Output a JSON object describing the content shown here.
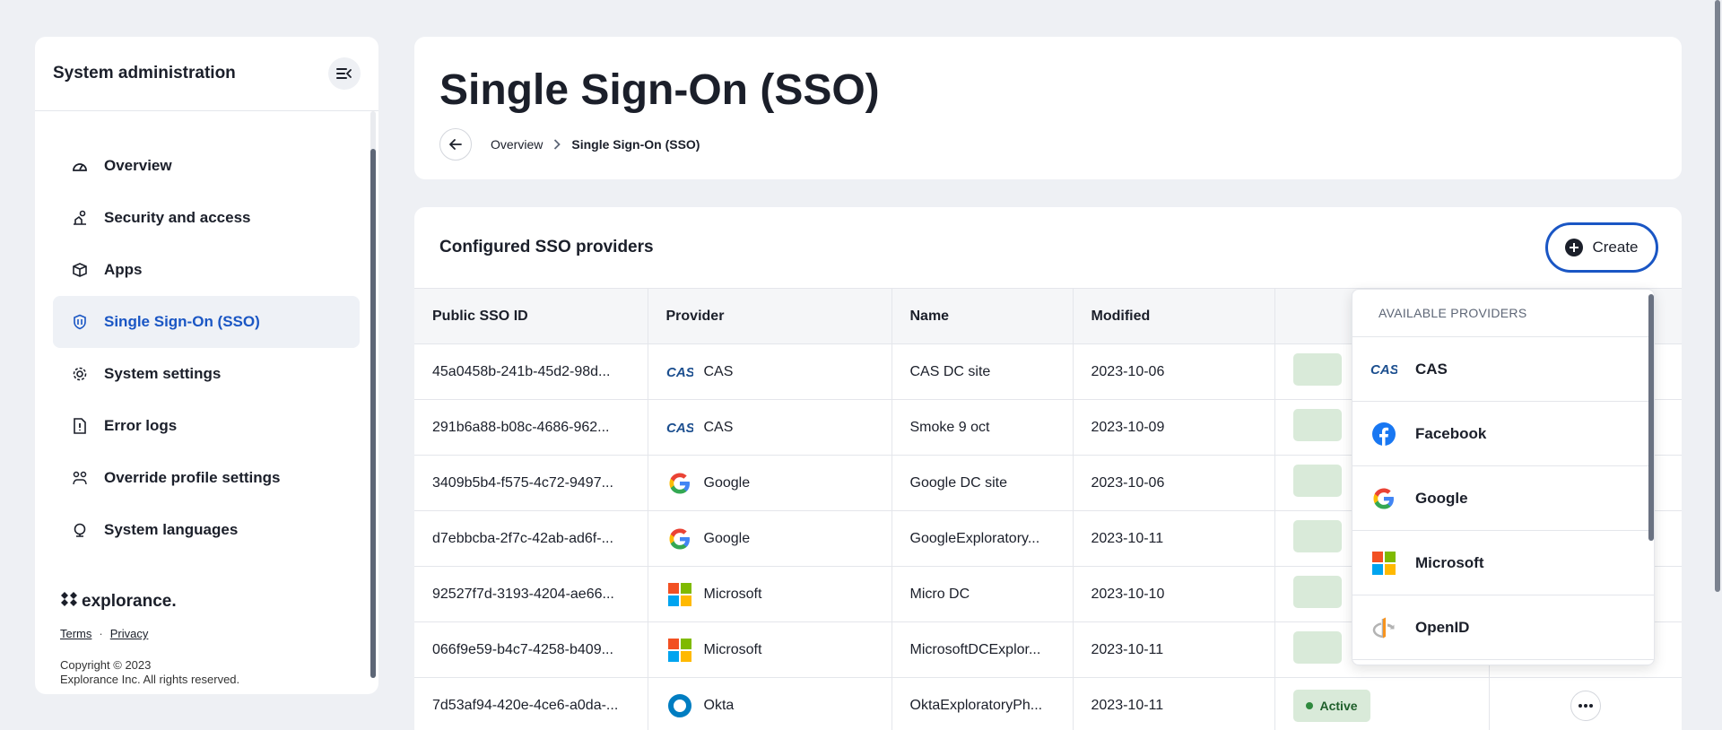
{
  "sidebar": {
    "title": "System administration",
    "items": [
      {
        "label": "Overview",
        "icon": "gauge-icon"
      },
      {
        "label": "Security and access",
        "icon": "security-icon"
      },
      {
        "label": "Apps",
        "icon": "apps-icon"
      },
      {
        "label": "Single Sign-On (SSO)",
        "icon": "shield-icon",
        "active": true
      },
      {
        "label": "System settings",
        "icon": "settings-icon"
      },
      {
        "label": "Error logs",
        "icon": "error-log-icon"
      },
      {
        "label": "Override profile settings",
        "icon": "override-icon"
      },
      {
        "label": "System languages",
        "icon": "globe-icon"
      }
    ],
    "footer": {
      "brand": "explorance.",
      "terms": "Terms",
      "separator": "·",
      "privacy": "Privacy",
      "copyright_line1": "Copyright © 2023",
      "copyright_line2": "Explorance Inc. All rights reserved."
    }
  },
  "header": {
    "title": "Single Sign-On (SSO)",
    "breadcrumb": {
      "parent": "Overview",
      "current": "Single Sign-On (SSO)"
    }
  },
  "providers_card": {
    "title": "Configured SSO providers",
    "create_label": "Create",
    "columns": [
      "Public SSO ID",
      "Provider",
      "Name",
      "Modified",
      "",
      ""
    ],
    "rows": [
      {
        "id": "45a0458b-241b-45d2-98d...",
        "provider": "CAS",
        "logo": "cas-logo",
        "name": "CAS DC site",
        "modified": "2023-10-06",
        "status": ""
      },
      {
        "id": "291b6a88-b08c-4686-962...",
        "provider": "CAS",
        "logo": "cas-logo",
        "name": "Smoke 9 oct",
        "modified": "2023-10-09",
        "status": ""
      },
      {
        "id": "3409b5b4-f575-4c72-9497...",
        "provider": "Google",
        "logo": "google-logo",
        "name": "Google DC site",
        "modified": "2023-10-06",
        "status": ""
      },
      {
        "id": "d7ebbcba-2f7c-42ab-ad6f-...",
        "provider": "Google",
        "logo": "google-logo",
        "name": "GoogleExploratory...",
        "modified": "2023-10-11",
        "status": ""
      },
      {
        "id": "92527f7d-3193-4204-ae66...",
        "provider": "Microsoft",
        "logo": "microsoft-logo",
        "name": "Micro DC",
        "modified": "2023-10-10",
        "status": ""
      },
      {
        "id": "066f9e59-b4c7-4258-b409...",
        "provider": "Microsoft",
        "logo": "microsoft-logo",
        "name": "MicrosoftDCExplor...",
        "modified": "2023-10-11",
        "status": ""
      },
      {
        "id": "7d53af94-420e-4ce6-a0da-...",
        "provider": "Okta",
        "logo": "okta-logo",
        "name": "OktaExploratoryPh...",
        "modified": "2023-10-11",
        "status": "Active"
      }
    ]
  },
  "dropdown": {
    "heading": "AVAILABLE PROVIDERS",
    "items": [
      {
        "label": "CAS",
        "logo": "cas-logo"
      },
      {
        "label": "Facebook",
        "logo": "facebook-logo"
      },
      {
        "label": "Google",
        "logo": "google-logo"
      },
      {
        "label": "Microsoft",
        "logo": "microsoft-logo"
      },
      {
        "label": "OpenID",
        "logo": "openid-logo"
      }
    ]
  },
  "colors": {
    "accent": "#1a56c4",
    "active_badge_bg": "#d9ead9",
    "active_badge_dot": "#2f8a3e"
  }
}
